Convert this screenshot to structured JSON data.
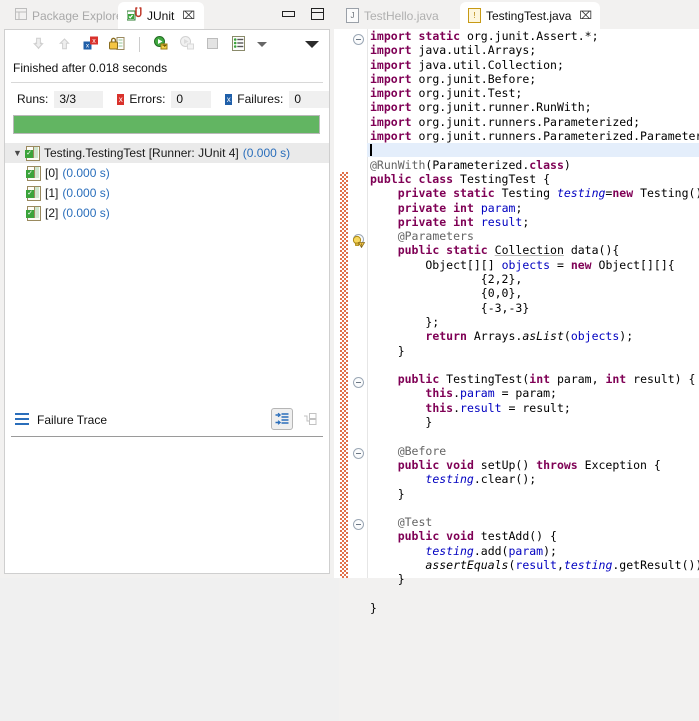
{
  "left_panel": {
    "tabs": [
      {
        "label": "Package Explorer",
        "icon": "package-explorer-icon",
        "active": false,
        "closable": false
      },
      {
        "label": "JUnit",
        "icon": "junit-icon",
        "active": true,
        "closable": true,
        "close_glyph": "⌧"
      }
    ],
    "view_buttons": [
      {
        "name": "minimize-button",
        "label": "Minimize"
      },
      {
        "name": "maximize-button",
        "label": "Maximize"
      }
    ],
    "toolbar": [
      {
        "name": "next-failure-button",
        "icon": "arrow-down-icon",
        "enabled": false
      },
      {
        "name": "previous-failure-button",
        "icon": "arrow-up-icon",
        "enabled": false
      },
      {
        "name": "show-failures-only-button",
        "icon": "failures-filter-icon",
        "enabled": true
      },
      {
        "name": "lock-scroll-button",
        "icon": "lock-icon",
        "enabled": true
      },
      {
        "name": "rerun-test-button",
        "icon": "rerun-green-icon",
        "enabled": true
      },
      {
        "name": "rerun-failed-button",
        "icon": "rerun-failed-icon",
        "enabled": false
      },
      {
        "name": "stop-button",
        "icon": "stop-square-icon",
        "enabled": false
      },
      {
        "name": "test-run-history-button",
        "icon": "history-list-icon",
        "enabled": true
      },
      {
        "name": "history-dropdown-button",
        "icon": "chevron-down-icon",
        "enabled": true
      },
      {
        "name": "view-menu-button",
        "icon": "view-menu-icon",
        "enabled": true
      }
    ],
    "status_text": "Finished after 0.018 seconds",
    "counters": {
      "runs_label": "Runs:",
      "runs_value": "3/3",
      "errors_label": "Errors:",
      "errors_value": "0",
      "errors_icon": "error-icon",
      "failures_label": "Failures:",
      "failures_value": "0",
      "failures_icon": "failure-icon"
    },
    "progress": {
      "percent": 100,
      "color": "#62b562",
      "state": "pass"
    },
    "tree": [
      {
        "label": "Testing.TestingTest [Runner: JUnit 4]",
        "time": "(0.000 s)",
        "expanded": true,
        "selected": true,
        "depth": 0
      },
      {
        "label": "[0]",
        "time": "(0.000 s)",
        "expanded": false,
        "selected": false,
        "depth": 1
      },
      {
        "label": "[1]",
        "time": "(0.000 s)",
        "expanded": false,
        "selected": false,
        "depth": 1
      },
      {
        "label": "[2]",
        "time": "(0.000 s)",
        "expanded": false,
        "selected": false,
        "depth": 1
      }
    ],
    "failure_trace": {
      "title": "Failure Trace",
      "icon": "failure-trace-icon",
      "buttons": [
        {
          "name": "filter-stack-trace-button",
          "icon": "filter-stack-icon",
          "pressed": true
        },
        {
          "name": "compare-result-button",
          "icon": "compare-icon",
          "pressed": false
        }
      ],
      "content": ""
    }
  },
  "editor_panel": {
    "tabs": [
      {
        "label": "TestHello.java",
        "icon": "java-file-icon",
        "active": false,
        "closable": false
      },
      {
        "label": "TestingTest.java",
        "icon": "java-file-warning-icon",
        "active": true,
        "closable": true,
        "close_glyph": "⌧"
      }
    ],
    "current_line": 9,
    "code_lines": [
      "import static org.junit.Assert.*;",
      "import java.util.Arrays;",
      "import java.util.Collection;",
      "import org.junit.Before;",
      "import org.junit.Test;",
      "import org.junit.runner.RunWith;",
      "import org.junit.runners.Parameterized;",
      "import org.junit.runners.Parameterized.Parameters;",
      "",
      "@RunWith(Parameterized.class)",
      "public class TestingTest {",
      "    private static Testing testing=new Testing();",
      "    private int param;",
      "    private int result;",
      "    @Parameters",
      "    public static Collection data(){",
      "        Object[][] objects = new Object[][]{",
      "                {2,2},",
      "                {0,0},",
      "                {-3,-3}",
      "        };",
      "        return Arrays.asList(objects);",
      "    }",
      "",
      "    public TestingTest(int param, int result) {",
      "        this.param = param;",
      "        this.result = result;",
      "        }",
      "",
      "    @Before",
      "    public void setUp() throws Exception {",
      "        testing.clear();",
      "    }",
      "",
      "    @Test",
      "    public void testAdd() {",
      "        testing.add(param);",
      "        assertEquals(result,testing.getResult());",
      "    }",
      "",
      "}"
    ],
    "folding_markers": [
      0,
      14,
      24,
      29,
      34
    ],
    "warning_marker_line": 15,
    "change_bar": {
      "color": "#e0714b",
      "from_line": 9,
      "to_line": 39
    }
  }
}
